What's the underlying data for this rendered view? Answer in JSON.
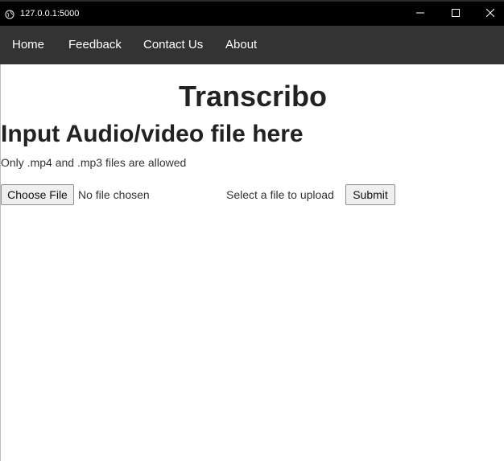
{
  "window": {
    "url": "127.0.0.1:5000",
    "icons": {
      "site": "globe-icon",
      "minimize": "minimize-icon",
      "maximize": "maximize-icon",
      "close": "close-icon"
    }
  },
  "nav": {
    "items": [
      {
        "label": "Home"
      },
      {
        "label": "Feedback"
      },
      {
        "label": "Contact Us"
      },
      {
        "label": "About"
      }
    ]
  },
  "main": {
    "title": "Transcribo",
    "heading": "Input Audio/video file here",
    "note": "Only .mp4 and .mp3 files are allowed",
    "choose_file_label": "Choose File",
    "no_file_text": "No file chosen",
    "select_label": "Select a file to upload",
    "submit_label": "Submit"
  },
  "colors": {
    "titlebar": "#000000",
    "navbar": "#333333",
    "text": "#222222",
    "background": "#ffffff"
  }
}
